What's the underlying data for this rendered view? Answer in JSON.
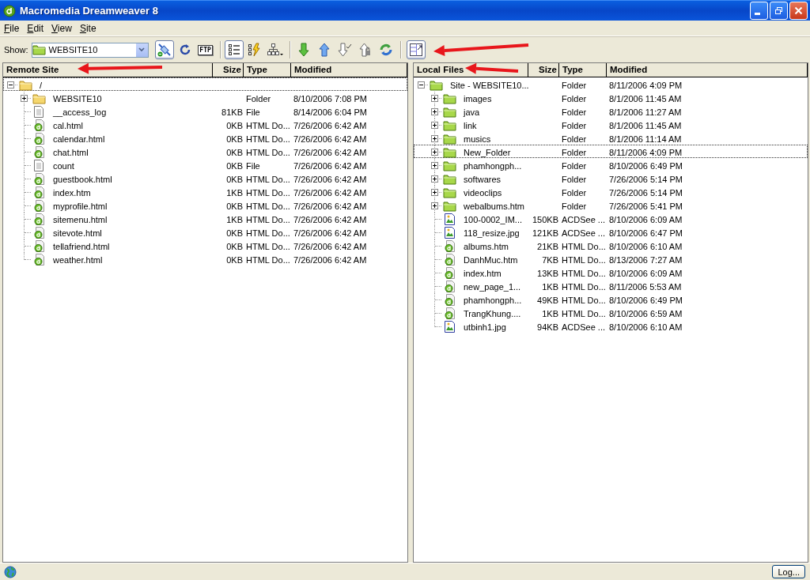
{
  "window": {
    "title": "Macromedia Dreamweaver 8"
  },
  "menu": [
    "File",
    "Edit",
    "View",
    "Site"
  ],
  "toolbar": {
    "show_label": "Show:",
    "site": "WEBSITE10",
    "ftp_label": "FTP",
    "buttons": [
      {
        "kind": "connect",
        "selected": true
      },
      {
        "kind": "refresh",
        "selected": false
      },
      {
        "kind": "ftp-log",
        "selected": false
      },
      {
        "kind": "separator"
      },
      {
        "kind": "files-view",
        "selected": true
      },
      {
        "kind": "testing-server",
        "selected": false
      },
      {
        "kind": "site-map",
        "selected": false
      },
      {
        "kind": "separator"
      },
      {
        "kind": "get",
        "selected": false
      },
      {
        "kind": "put",
        "selected": false
      },
      {
        "kind": "check-out",
        "selected": false
      },
      {
        "kind": "check-in",
        "selected": false
      },
      {
        "kind": "synchronize",
        "selected": false
      },
      {
        "kind": "separator"
      },
      {
        "kind": "expand",
        "selected": true
      }
    ]
  },
  "remote_panel": {
    "kind": "remote",
    "columns": [
      "Remote Site",
      "Size",
      "Type",
      "Modified"
    ],
    "tree": [
      {
        "name": "/",
        "kind": "folder",
        "expanded": true,
        "focused": true,
        "children": [
          {
            "name": "WEBSITE10",
            "kind": "folder",
            "expanded": false,
            "focused": false,
            "type": "Folder",
            "modified": "8/10/2006 7:08 PM"
          },
          {
            "name": "__access_log",
            "kind": "file",
            "focused": false,
            "size": "81KB",
            "type": "File",
            "modified": "8/14/2006 6:04 PM"
          },
          {
            "name": "cal.html",
            "kind": "html",
            "focused": false,
            "size": "0KB",
            "type": "HTML Do...",
            "modified": "7/26/2006 6:42 AM"
          },
          {
            "name": "calendar.html",
            "kind": "html",
            "focused": false,
            "size": "0KB",
            "type": "HTML Do...",
            "modified": "7/26/2006 6:42 AM"
          },
          {
            "name": "chat.html",
            "kind": "html",
            "focused": false,
            "size": "0KB",
            "type": "HTML Do...",
            "modified": "7/26/2006 6:42 AM"
          },
          {
            "name": "count",
            "kind": "file",
            "focused": false,
            "size": "0KB",
            "type": "File",
            "modified": "7/26/2006 6:42 AM"
          },
          {
            "name": "guestbook.html",
            "kind": "html",
            "focused": false,
            "size": "0KB",
            "type": "HTML Do...",
            "modified": "7/26/2006 6:42 AM"
          },
          {
            "name": "index.htm",
            "kind": "html",
            "focused": false,
            "size": "1KB",
            "type": "HTML Do...",
            "modified": "7/26/2006 6:42 AM"
          },
          {
            "name": "myprofile.html",
            "kind": "html",
            "focused": false,
            "size": "0KB",
            "type": "HTML Do...",
            "modified": "7/26/2006 6:42 AM"
          },
          {
            "name": "sitemenu.html",
            "kind": "html",
            "focused": false,
            "size": "1KB",
            "type": "HTML Do...",
            "modified": "7/26/2006 6:42 AM"
          },
          {
            "name": "sitevote.html",
            "kind": "html",
            "focused": false,
            "size": "0KB",
            "type": "HTML Do...",
            "modified": "7/26/2006 6:42 AM"
          },
          {
            "name": "tellafriend.html",
            "kind": "html",
            "focused": false,
            "size": "0KB",
            "type": "HTML Do...",
            "modified": "7/26/2006 6:42 AM"
          },
          {
            "name": "weather.html",
            "kind": "html",
            "focused": false,
            "size": "0KB",
            "type": "HTML Do...",
            "modified": "7/26/2006 6:42 AM"
          }
        ]
      }
    ]
  },
  "local_panel": {
    "kind": "local",
    "columns": [
      "Local Files",
      "Size",
      "Type",
      "Modified"
    ],
    "tree": [
      {
        "name": "Site - WEBSITE10...",
        "kind": "site",
        "expanded": true,
        "focused": false,
        "type": "Folder",
        "modified": "8/11/2006 4:09 PM",
        "children": [
          {
            "name": "images",
            "kind": "folder",
            "expanded": false,
            "focused": false,
            "type": "Folder",
            "modified": "8/1/2006 11:45 AM"
          },
          {
            "name": "java",
            "kind": "folder",
            "expanded": false,
            "focused": false,
            "type": "Folder",
            "modified": "8/1/2006 11:27 AM"
          },
          {
            "name": "link",
            "kind": "folder",
            "expanded": false,
            "focused": false,
            "type": "Folder",
            "modified": "8/1/2006 11:45 AM"
          },
          {
            "name": "musics",
            "kind": "folder",
            "expanded": false,
            "focused": false,
            "type": "Folder",
            "modified": "8/1/2006 11:14 AM"
          },
          {
            "name": "New_Folder",
            "kind": "folder",
            "expanded": false,
            "focused": true,
            "type": "Folder",
            "modified": "8/11/2006 4:09 PM"
          },
          {
            "name": "phamhongph...",
            "kind": "folder",
            "expanded": false,
            "focused": false,
            "type": "Folder",
            "modified": "8/10/2006 6:49 PM"
          },
          {
            "name": "softwares",
            "kind": "folder",
            "expanded": false,
            "focused": false,
            "type": "Folder",
            "modified": "7/26/2006 5:14 PM"
          },
          {
            "name": "videoclips",
            "kind": "folder",
            "expanded": false,
            "focused": false,
            "type": "Folder",
            "modified": "7/26/2006 5:14 PM"
          },
          {
            "name": "webalbums.htm",
            "kind": "folder",
            "expanded": false,
            "focused": false,
            "type": "Folder",
            "modified": "7/26/2006 5:41 PM"
          },
          {
            "name": "100-0002_IM...",
            "kind": "image",
            "focused": false,
            "size": "150KB",
            "type": "ACDSee ...",
            "modified": "8/10/2006 6:09 AM"
          },
          {
            "name": "118_resize.jpg",
            "kind": "image",
            "focused": false,
            "size": "121KB",
            "type": "ACDSee ...",
            "modified": "8/10/2006 6:47 PM"
          },
          {
            "name": "albums.htm",
            "kind": "html",
            "focused": false,
            "size": "21KB",
            "type": "HTML Do...",
            "modified": "8/10/2006 6:10 AM"
          },
          {
            "name": "DanhMuc.htm",
            "kind": "html",
            "focused": false,
            "size": "7KB",
            "type": "HTML Do...",
            "modified": "8/13/2006 7:27 AM"
          },
          {
            "name": "index.htm",
            "kind": "html",
            "focused": false,
            "size": "13KB",
            "type": "HTML Do...",
            "modified": "8/10/2006 6:09 AM"
          },
          {
            "name": "new_page_1...",
            "kind": "html",
            "focused": false,
            "size": "1KB",
            "type": "HTML Do...",
            "modified": "8/11/2006 5:53 AM"
          },
          {
            "name": "phamhongph...",
            "kind": "html",
            "focused": false,
            "size": "49KB",
            "type": "HTML Do...",
            "modified": "8/10/2006 6:49 PM"
          },
          {
            "name": "TrangKhung....",
            "kind": "html",
            "focused": false,
            "size": "1KB",
            "type": "HTML Do...",
            "modified": "8/10/2006 6:59 AM"
          },
          {
            "name": "utbinh1.jpg",
            "kind": "image",
            "focused": false,
            "size": "94KB",
            "type": "ACDSee ...",
            "modified": "8/10/2006 6:10 AM"
          }
        ]
      }
    ]
  },
  "status_bar": {
    "log_button": "Log..."
  }
}
